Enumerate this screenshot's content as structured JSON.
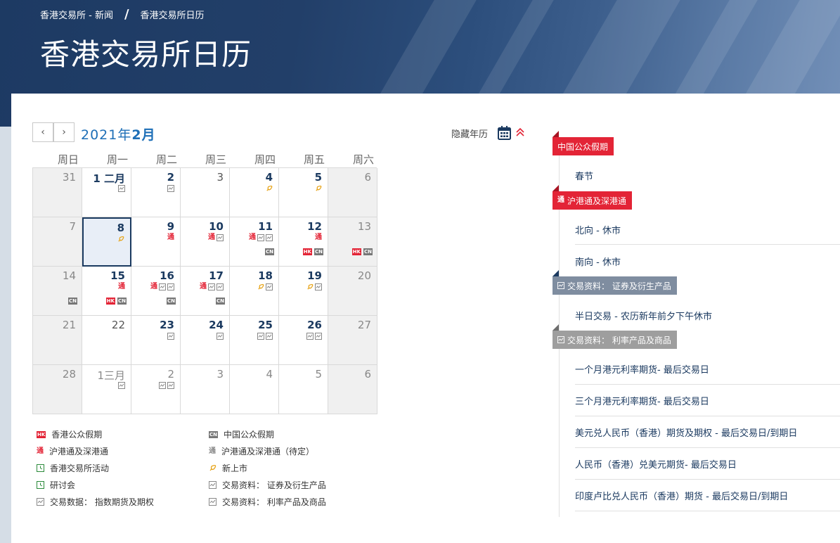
{
  "breadcrumb": {
    "home": "香港交易所 - 新闻",
    "separator": "/",
    "current": "香港交易所日历"
  },
  "page_title": "香港交易所日历",
  "calendar": {
    "prev_label": "‹",
    "next_label": "›",
    "year_label": "2021年",
    "month_label": "2月",
    "hide_year_label": "隐藏年历",
    "weekdays": [
      "周日",
      "周一",
      "周二",
      "周三",
      "周四",
      "周五",
      "周六"
    ],
    "selected_day": "8",
    "days": [
      {
        "label": "31",
        "style": "grey"
      },
      {
        "label": "1 二月",
        "style": "event",
        "row1": [
          "data"
        ]
      },
      {
        "label": "2",
        "style": "event",
        "row1": [
          "data"
        ]
      },
      {
        "label": "3",
        "style": "normal"
      },
      {
        "label": "4",
        "style": "event",
        "row1": [
          "listing"
        ]
      },
      {
        "label": "5",
        "style": "event",
        "row1": [
          "listing"
        ]
      },
      {
        "label": "6",
        "style": "grey"
      },
      {
        "label": "7",
        "style": "grey"
      },
      {
        "label": "8",
        "style": "selected",
        "row1": [
          "listing"
        ]
      },
      {
        "label": "9",
        "style": "event",
        "row1": [
          "tong"
        ]
      },
      {
        "label": "10",
        "style": "event",
        "row1": [
          "tong",
          "data"
        ]
      },
      {
        "label": "11",
        "style": "event",
        "row1": [
          "tong",
          "data",
          "data"
        ],
        "row2": [
          "cn"
        ]
      },
      {
        "label": "12",
        "style": "event",
        "row1": [
          "tong"
        ],
        "row2": [
          "hk",
          "cn"
        ]
      },
      {
        "label": "13",
        "style": "grey",
        "row2": [
          "hk",
          "cn"
        ]
      },
      {
        "label": "14",
        "style": "grey",
        "row2": [
          "cn"
        ]
      },
      {
        "label": "15",
        "style": "event",
        "row1": [
          "tong"
        ],
        "row2": [
          "hk",
          "cn"
        ]
      },
      {
        "label": "16",
        "style": "event",
        "row1": [
          "tong",
          "data",
          "data"
        ],
        "row2": [
          "cn"
        ]
      },
      {
        "label": "17",
        "style": "event",
        "row1": [
          "tong",
          "data",
          "data"
        ],
        "row2": [
          "cn"
        ]
      },
      {
        "label": "18",
        "style": "event",
        "row1": [
          "listing",
          "data"
        ]
      },
      {
        "label": "19",
        "style": "event",
        "row1": [
          "listing",
          "data"
        ]
      },
      {
        "label": "20",
        "style": "grey"
      },
      {
        "label": "21",
        "style": "grey"
      },
      {
        "label": "22",
        "style": "normal"
      },
      {
        "label": "23",
        "style": "event",
        "row1": [
          "data"
        ]
      },
      {
        "label": "24",
        "style": "event",
        "row1": [
          "data"
        ]
      },
      {
        "label": "25",
        "style": "event",
        "row1": [
          "data",
          "data"
        ]
      },
      {
        "label": "26",
        "style": "event",
        "row1": [
          "data",
          "data"
        ]
      },
      {
        "label": "27",
        "style": "grey"
      },
      {
        "label": "28",
        "style": "grey"
      },
      {
        "label": "1三月",
        "style": "faded",
        "row1": [
          "data"
        ]
      },
      {
        "label": "2",
        "style": "faded",
        "row1": [
          "data",
          "data"
        ]
      },
      {
        "label": "3",
        "style": "faded"
      },
      {
        "label": "4",
        "style": "faded"
      },
      {
        "label": "5",
        "style": "faded"
      },
      {
        "label": "6",
        "style": "grey"
      }
    ],
    "tong_mark": "通",
    "hk_mark": "HK",
    "cn_mark": "CN"
  },
  "legend": {
    "hk_holiday": "香港公众假期",
    "cn_holiday": "中国公众假期",
    "connect": "沪港通及深港通",
    "connect_tbc": "沪港通及深港通（待定）",
    "hkex_event": "香港交易所活动",
    "new_listing": "新上市",
    "seminar": "研讨会",
    "data_securities": "交易资料： 证券及衍生产品",
    "data_index": "交易数据： 指数期货及期权",
    "data_rates": "交易资料： 利率产品及商品"
  },
  "events": {
    "tag_cn_holiday": "中国公众假期",
    "cn_holiday_item": "春节",
    "tag_connect": "沪港通及深港通",
    "connect_items": [
      "北向 - 休市",
      "南向 - 休市"
    ],
    "tag_securities": "交易资料： 证券及衍生产品",
    "securities_item": "半日交易 - 农历新年前夕下午休市",
    "tag_rates": "交易资料： 利率产品及商品",
    "rates_items": [
      "一个月港元利率期货- 最后交易日",
      "三个月港元利率期货- 最后交易日",
      "美元兑人民币（香港）期货及期权 - 最后交易日/到期日",
      "人民币（香港）兑美元期货- 最后交易日",
      "印度卢比兑人民币（香港）期货 - 最后交易日/到期日"
    ]
  },
  "colors": {
    "brand_navy": "#1b3a60",
    "accent_blue": "#1e6fb7",
    "red": "#e32436",
    "slate": "#7f8da0",
    "grey_tag": "#9e9e9e",
    "listing_gold": "#e7a51c"
  }
}
